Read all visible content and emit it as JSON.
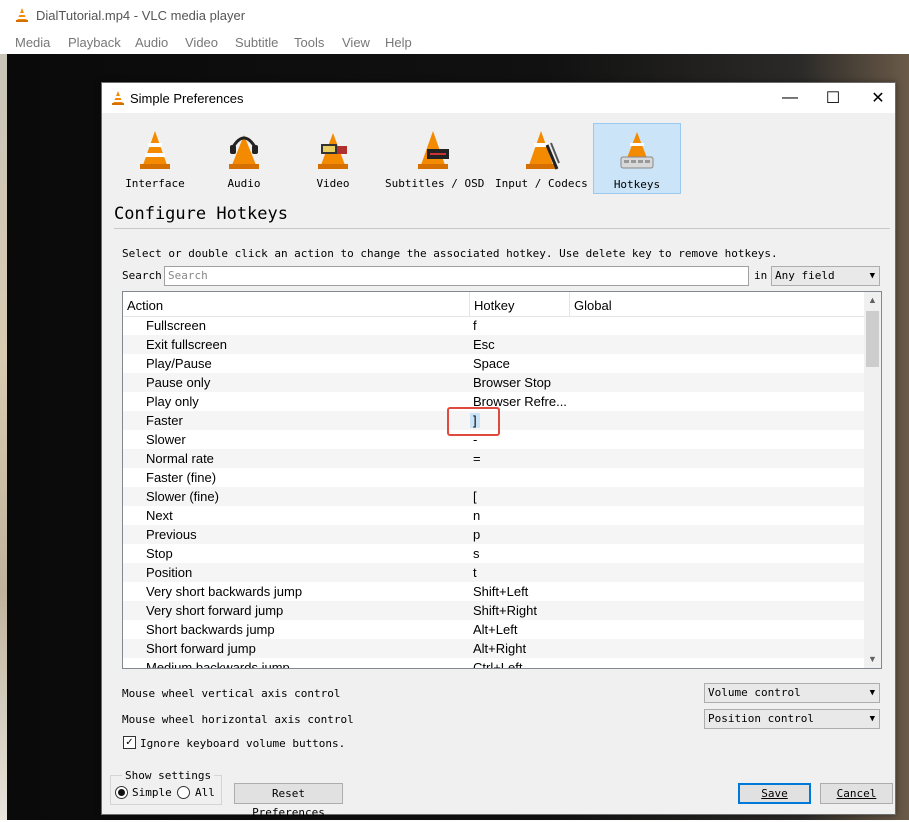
{
  "main_window": {
    "title": "DialTutorial.mp4 - VLC media player",
    "menu": [
      "Media",
      "Playback",
      "Audio",
      "Video",
      "Subtitle",
      "Tools",
      "View",
      "Help"
    ]
  },
  "dialog": {
    "title": "Simple Preferences",
    "window_buttons": {
      "minimize": "—",
      "maximize": "☐",
      "close": "✕"
    },
    "categories": [
      {
        "label": "Interface",
        "icon": "vlc-cone-icon"
      },
      {
        "label": "Audio",
        "icon": "headphones-cone-icon"
      },
      {
        "label": "Video",
        "icon": "video-cone-icon"
      },
      {
        "label": "Subtitles / OSD",
        "icon": "subtitles-cone-icon"
      },
      {
        "label": "Input / Codecs",
        "icon": "codecs-cone-icon"
      },
      {
        "label": "Hotkeys",
        "icon": "hotkeys-cone-icon",
        "selected": true
      }
    ],
    "heading": "Configure Hotkeys",
    "instructions": "Select or double click an action to change the associated hotkey. Use delete key to remove hotkeys.",
    "search": {
      "label": "Search",
      "placeholder": "Search",
      "in_label": "in",
      "scope": "Any field"
    },
    "table": {
      "columns": [
        "Action",
        "Hotkey",
        "Global"
      ],
      "rows": [
        {
          "action": "Fullscreen",
          "hotkey": "f"
        },
        {
          "action": "Exit fullscreen",
          "hotkey": "Esc"
        },
        {
          "action": "Play/Pause",
          "hotkey": "Space"
        },
        {
          "action": "Pause only",
          "hotkey": "Browser Stop"
        },
        {
          "action": "Play only",
          "hotkey": "Browser Refre..."
        },
        {
          "action": "Faster",
          "hotkey": "]"
        },
        {
          "action": "Slower",
          "hotkey": "-"
        },
        {
          "action": "Normal rate",
          "hotkey": "="
        },
        {
          "action": "Faster (fine)",
          "hotkey": ""
        },
        {
          "action": "Slower (fine)",
          "hotkey": "["
        },
        {
          "action": "Next",
          "hotkey": "n"
        },
        {
          "action": "Previous",
          "hotkey": "p"
        },
        {
          "action": "Stop",
          "hotkey": "s"
        },
        {
          "action": "Position",
          "hotkey": "t"
        },
        {
          "action": "Very short backwards jump",
          "hotkey": "Shift+Left"
        },
        {
          "action": "Very short forward jump",
          "hotkey": "Shift+Right"
        },
        {
          "action": "Short backwards jump",
          "hotkey": "Alt+Left"
        },
        {
          "action": "Short forward jump",
          "hotkey": "Alt+Right"
        },
        {
          "action": "Medium backwards jump",
          "hotkey": "Ctrl+Left"
        }
      ]
    },
    "mouse_vertical": {
      "label": "Mouse wheel vertical axis control",
      "value": "Volume control"
    },
    "mouse_horizontal": {
      "label": "Mouse wheel horizontal axis control",
      "value": "Position control"
    },
    "ignore_volume": {
      "label": "Ignore keyboard volume buttons.",
      "checked": true
    },
    "show_settings": {
      "legend": "Show settings",
      "simple": "Simple",
      "all": "All",
      "selected": "Simple"
    },
    "buttons": {
      "reset": "Reset Preferences",
      "save": "Save",
      "cancel": "Cancel"
    }
  },
  "colors": {
    "selection": "#cce4f7",
    "annotation": "#e04a3c",
    "vlc_orange": "#f48a00"
  }
}
